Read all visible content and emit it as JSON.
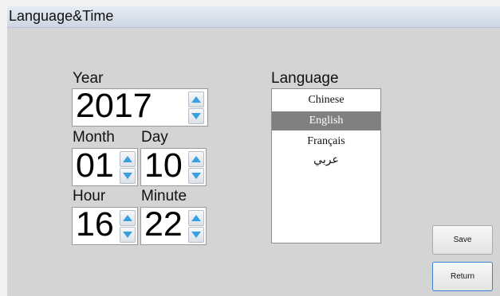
{
  "window": {
    "title": "Language&Time"
  },
  "datetime": {
    "year_label": "Year",
    "year": "2017",
    "month_label": "Month",
    "month": "01",
    "day_label": "Day",
    "day": "10",
    "hour_label": "Hour",
    "hour": "16",
    "minute_label": "Minute",
    "minute": "22"
  },
  "language": {
    "label": "Language",
    "items": [
      "Chinese",
      "English",
      "Français",
      "عربي"
    ],
    "selected": "English"
  },
  "buttons": {
    "save_label": "Save",
    "return_label": "Return"
  },
  "colors": {
    "selection": "#808080",
    "focus_border": "#3b7fd6",
    "spin_arrow": "#3aa0e0"
  }
}
